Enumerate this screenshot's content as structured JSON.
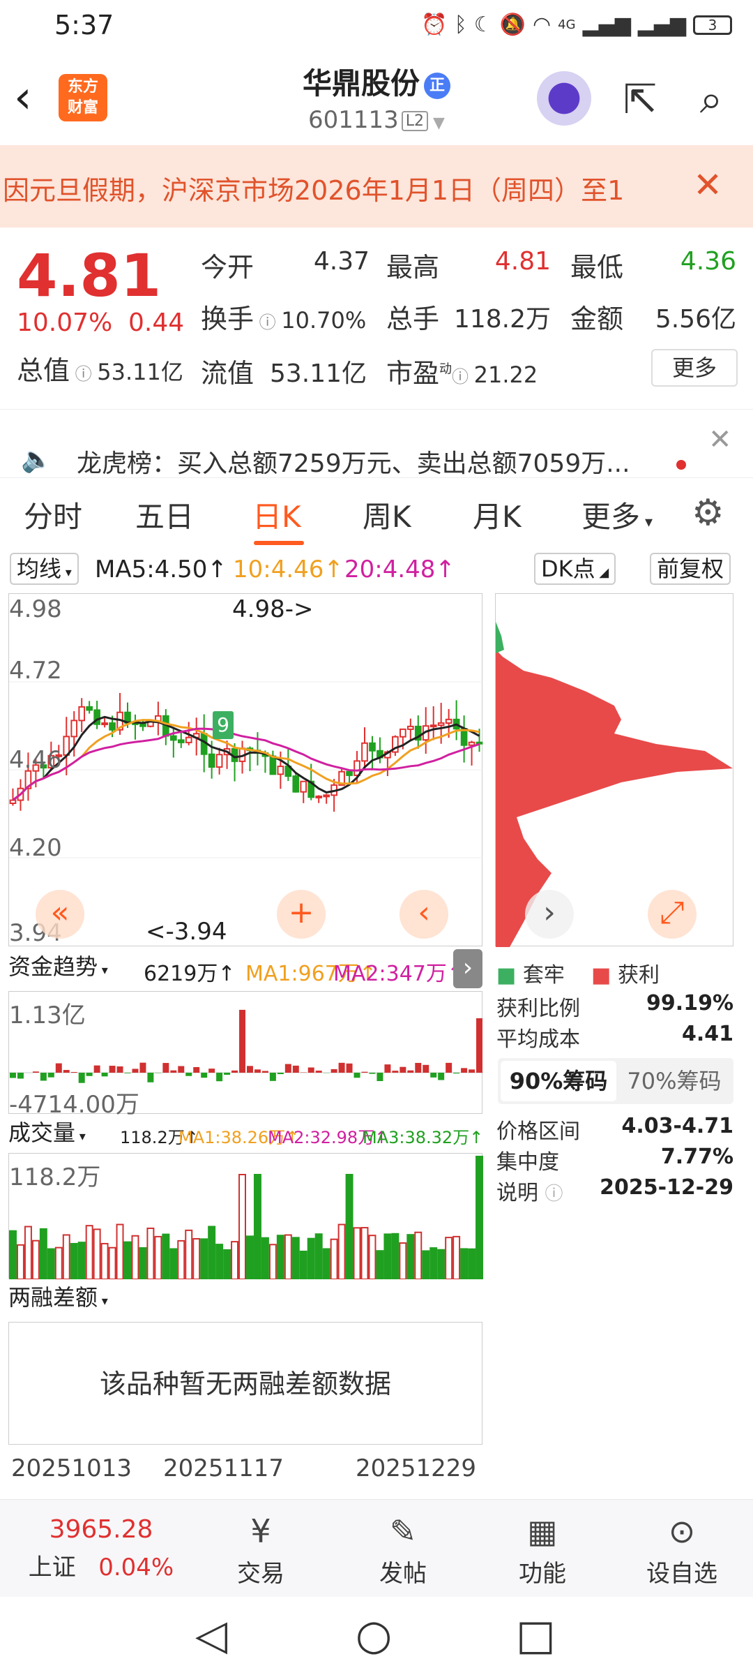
{
  "status": {
    "time": "5:37",
    "network": "4G",
    "battery": "3"
  },
  "header": {
    "logo_line1": "东方",
    "logo_line2": "财富",
    "name": "华鼎股份",
    "tag": "正",
    "code": "601113",
    "level": "L2"
  },
  "notice": {
    "text": "因元旦假期，沪深京市场2026年1月1日（周四）至1",
    "close": "✕"
  },
  "quote": {
    "price": "4.81",
    "change_pct": "10.07%",
    "change": "0.44",
    "open_label": "今开",
    "open": "4.37",
    "high_label": "最高",
    "high": "4.81",
    "low_label": "最低",
    "low": "4.36",
    "turnover_label": "换手",
    "turnover": "10.70%",
    "volume_label": "总手",
    "volume": "118.2万",
    "amount_label": "金额",
    "amount": "5.56亿",
    "total_value_label": "总值",
    "total_value": "53.11亿",
    "float_value_label": "流值",
    "float_value": "53.11亿",
    "pe_label": "市盈",
    "pe_sup": "动",
    "pe": "21.22",
    "more": "更多"
  },
  "dragon": {
    "text": "龙虎榜：买入总额7259万元、卖出总额7059万..."
  },
  "tabs": [
    "分时",
    "五日",
    "日K",
    "周K",
    "月K",
    "更多"
  ],
  "active_tab": "日K",
  "ma": {
    "selector": "均线",
    "ma5": "MA5:4.50↑",
    "ma10": "10:4.46↑",
    "ma20": "20:4.48↑",
    "dk": "DK点",
    "fq": "前复权",
    "color_ma5": "#222222",
    "color_ma10": "#f0a020",
    "color_ma20": "#d020a0"
  },
  "kchart": {
    "y_top": "4.98",
    "y2": "4.72",
    "y3": "4.46",
    "y4": "4.20",
    "y_bottom": "3.94",
    "high_mark": "4.98->",
    "low_mark": "<-3.94",
    "signal": "9"
  },
  "fund": {
    "selector": "资金趋势",
    "value": "6219万↑",
    "ma1": "MA1:967万↑",
    "ma2": "MA2:347万↑",
    "y_top": "1.13亿",
    "y_bottom": "-4714.00万"
  },
  "volume": {
    "selector": "成交量",
    "value": "118.2万↑",
    "ma1": "MA1:38.26万↑",
    "ma2": "MA2:32.98万↑",
    "ma3": "MA3:38.32万↑",
    "y_top": "118.2万"
  },
  "margin": {
    "selector": "两融差额",
    "empty": "该品种暂无两融差额数据"
  },
  "dates": [
    "20251013",
    "20251117",
    "20251229"
  ],
  "chips": {
    "legend_trap": "套牢",
    "legend_profit": "获利",
    "profit_ratio_label": "获利比例",
    "profit_ratio": "99.19%",
    "avg_cost_label": "平均成本",
    "avg_cost": "4.41",
    "tab90": "90%筹码",
    "tab70": "70%筹码",
    "range_label": "价格区间",
    "range": "4.03-4.71",
    "concentration_label": "集中度",
    "concentration": "7.77%",
    "note_label": "说明",
    "note": "2025-12-29"
  },
  "bottom": {
    "index_value": "3965.28",
    "index_name": "上证",
    "index_change": "0.04%",
    "trade": "交易",
    "post": "发帖",
    "function": "功能",
    "watch": "设自选"
  }
}
